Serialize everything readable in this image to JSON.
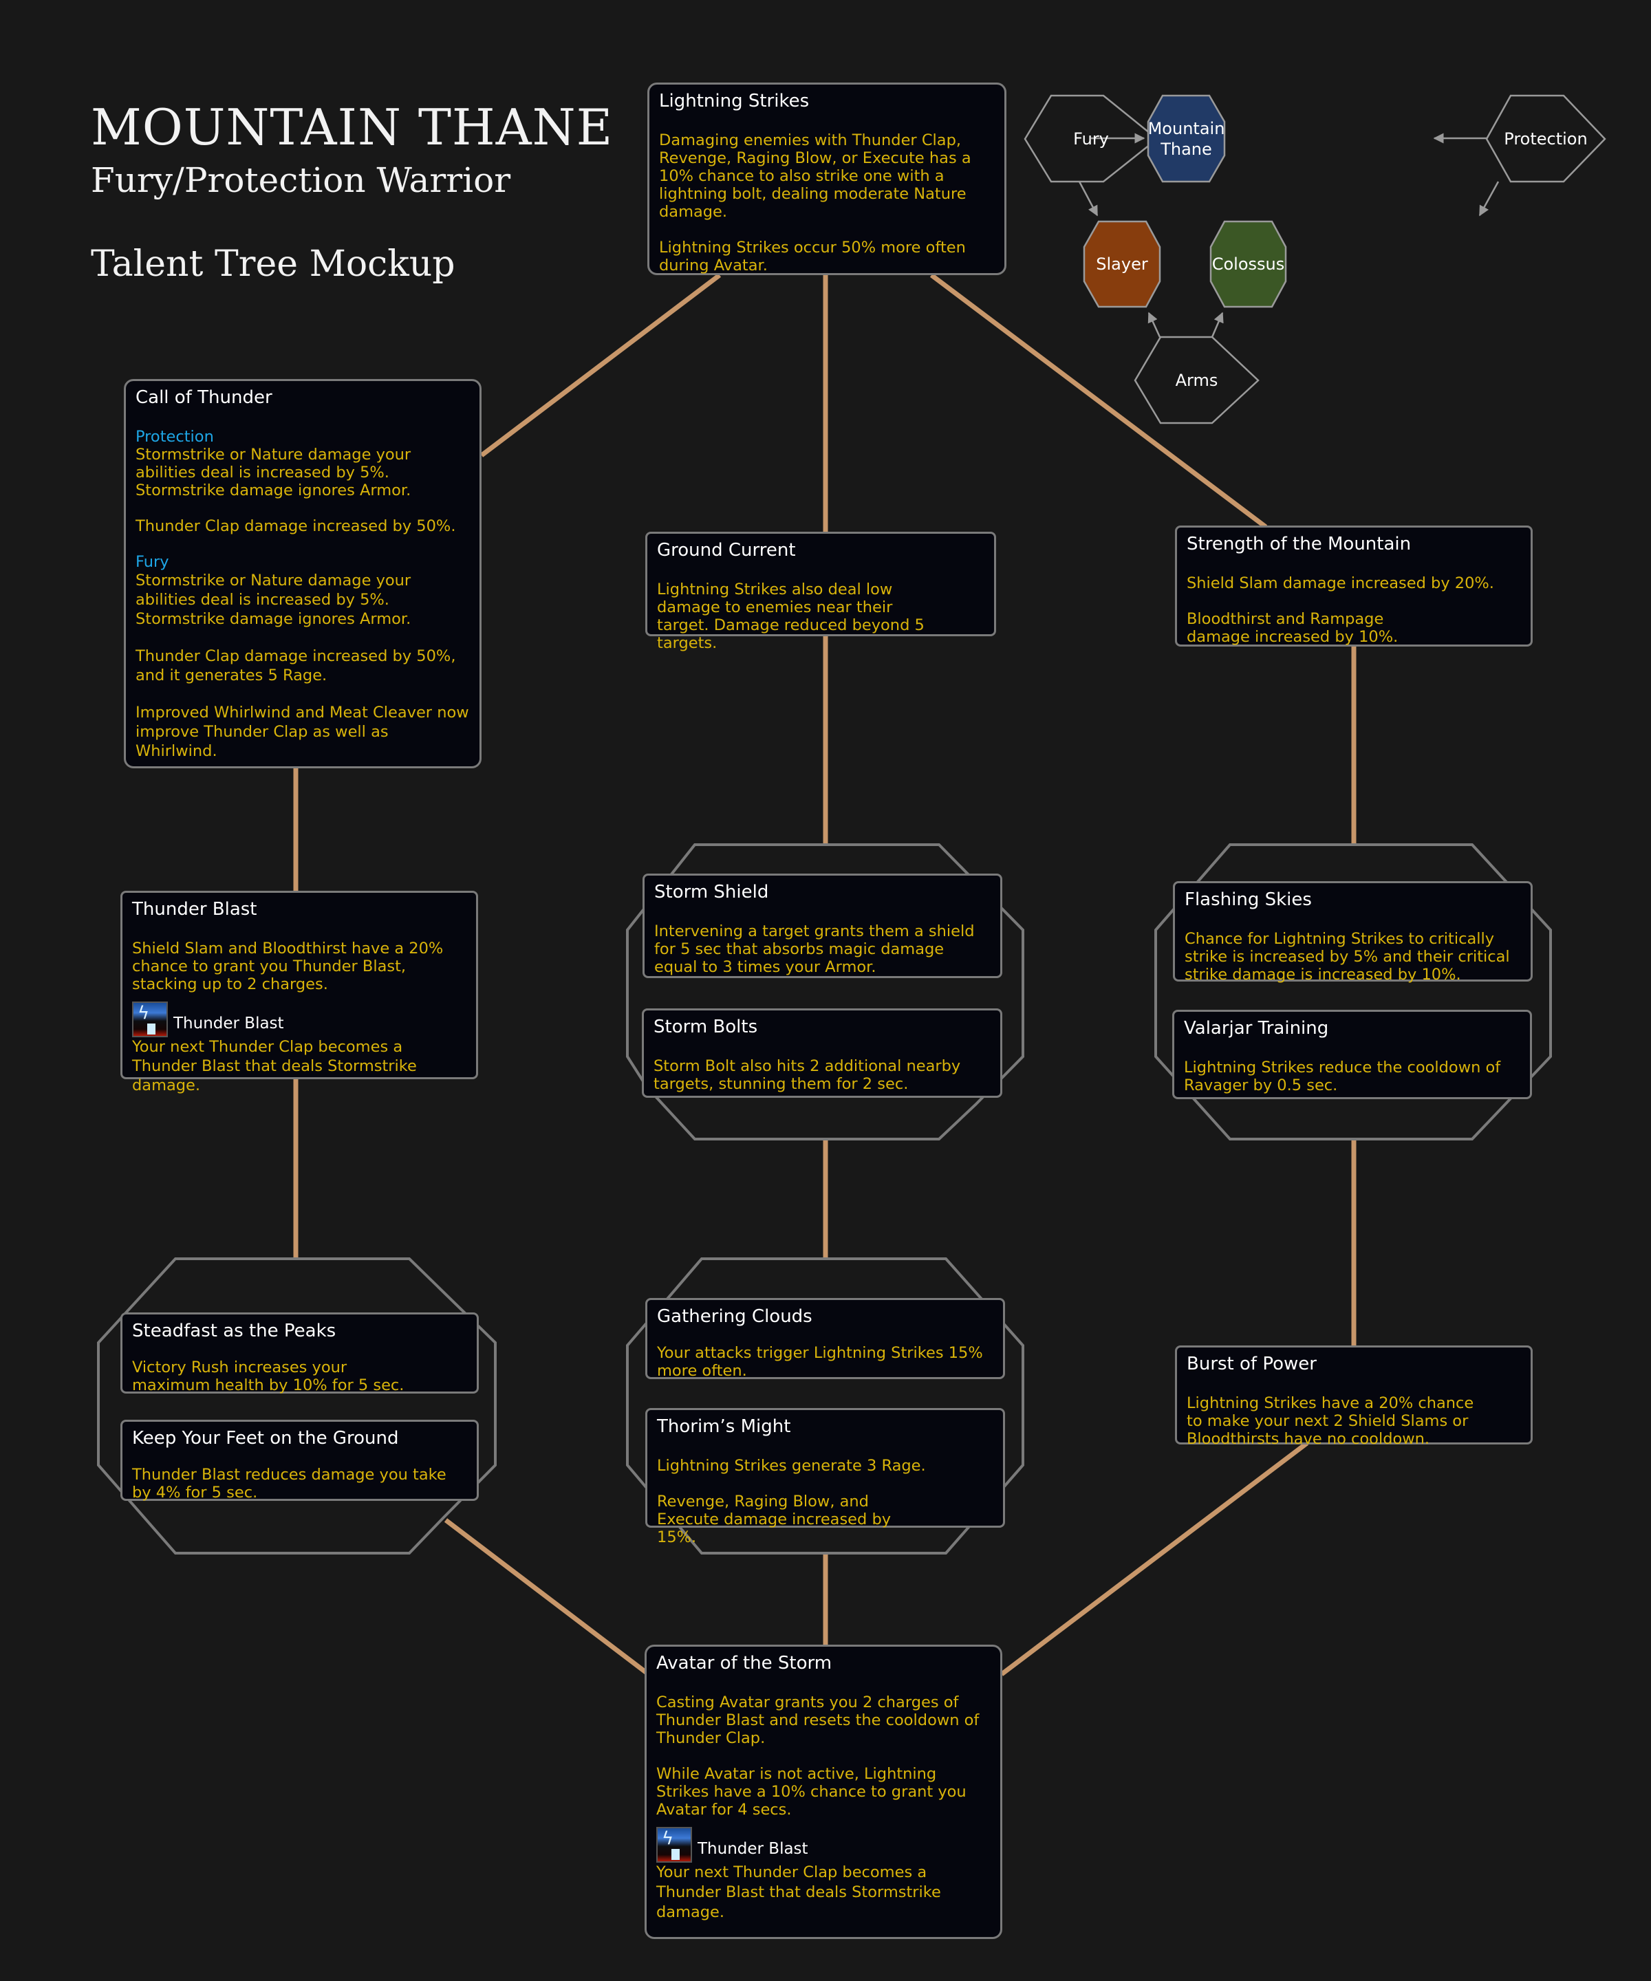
{
  "header": {
    "title": "MOUNTAIN THANE",
    "subtitle": "Fury/Protection Warrior",
    "caption": "Talent Tree Mockup"
  },
  "colors": {
    "background": "#181818",
    "card_bg": "#05060e",
    "card_border": "#7a7a7a",
    "connector": "#c8976a",
    "title_text": "#ffffff",
    "body_text": "#d9b40a",
    "spec_label": "#1ea6e6",
    "mountain_thane": "#213a66",
    "slayer": "#873d0d",
    "colossus": "#3b5725"
  },
  "spec_map": {
    "nodes": {
      "fury": "Fury",
      "mountain_thane_1": "Mountain",
      "mountain_thane_2": "Thane",
      "protection": "Protection",
      "slayer": "Slayer",
      "colossus": "Colossus",
      "arms": "Arms"
    },
    "edges": [
      {
        "from": "Fury",
        "to": "Mountain Thane"
      },
      {
        "from": "Protection",
        "to": "Mountain Thane"
      },
      {
        "from": "Fury",
        "to": "Slayer"
      },
      {
        "from": "Protection",
        "to": "Colossus"
      },
      {
        "from": "Arms",
        "to": "Slayer"
      },
      {
        "from": "Arms",
        "to": "Colossus"
      }
    ]
  },
  "talents": {
    "lightning_strikes": {
      "name": "Lightning Strikes",
      "p1": "Damaging enemies with Thunder Clap, Revenge, Raging Blow, or Execute has a 10% chance to also strike one with a lightning bolt, dealing moderate Nature damage.",
      "p2": "Lightning Strikes occur 50% more often during Avatar."
    },
    "call_of_thunder": {
      "name": "Call of Thunder",
      "spec1": "Protection",
      "p1": "Stormstrike or Nature damage your abilities deal is increased by 5%. Stormstrike damage ignores Armor.",
      "p2": "Thunder Clap damage increased by 50%.",
      "spec2": "Fury",
      "p3": "Stormstrike or Nature damage your abilities deal is increased by 5%. Stormstrike damage ignores Armor.",
      "p4": "Thunder Clap damage increased by 50%, and it generates 5 Rage.",
      "p5": "Improved Whirlwind and Meat Cleaver now improve Thunder Clap as well as Whirlwind."
    },
    "ground_current": {
      "name": "Ground Current",
      "p1": "Lightning Strikes also deal low damage to  enemies near their target. Damage reduced beyond 5 targets."
    },
    "strength_of_the_mountain": {
      "name": "Strength of the Mountain",
      "p1": "Shield Slam damage increased by 20%.",
      "p2": "Bloodthirst and Rampage damage increased by 10%."
    },
    "thunder_blast": {
      "name": "Thunder Blast",
      "p1": "Shield Slam and Bloodthirst have a 20% chance to grant you Thunder Blast, stacking up to 2 charges.",
      "ability_name": "Thunder Blast",
      "ability_desc": "Your next Thunder Clap becomes a Thunder Blast that deals Stormstrike damage."
    },
    "storm_shield": {
      "name": "Storm Shield",
      "p1": "Intervening a target grants them a shield for 5 sec that absorbs magic damage equal to 3 times your Armor."
    },
    "storm_bolts": {
      "name": "Storm Bolts",
      "p1": "Storm Bolt also hits 2 additional nearby targets, stunning them for 2 sec."
    },
    "flashing_skies": {
      "name": "Flashing Skies",
      "p1": "Chance for Lightning Strikes to critically strike is increased by 5% and their critical strike damage is increased by 10%."
    },
    "valarjar_training": {
      "name": "Valarjar Training",
      "p1": "Lightning Strikes reduce the cooldown of Ravager by 0.5 sec."
    },
    "steadfast_as_the_peaks": {
      "name": "Steadfast as the Peaks",
      "p1": "Victory Rush increases your maximum health by 10% for 5 sec."
    },
    "keep_your_feet_on_the_ground": {
      "name": "Keep Your Feet on the Ground",
      "p1": "Thunder Blast reduces damage you take by 4% for 5 sec."
    },
    "gathering_clouds": {
      "name": "Gathering Clouds",
      "p1": "Your attacks trigger Lightning Strikes 15% more often."
    },
    "thorims_might": {
      "name": "Thorim’s Might",
      "p1": "Lightning Strikes generate 3 Rage.",
      "p2": "Revenge, Raging Blow, and Execute damage increased by 15%."
    },
    "burst_of_power": {
      "name": "Burst of Power",
      "p1": "Lightning Strikes have a 20% chance to make your next 2 Shield Slams or Bloodthirsts have no cooldown."
    },
    "avatar_of_the_storm": {
      "name": "Avatar of the Storm",
      "p1": "Casting Avatar grants you 2 charges of Thunder Blast and resets the cooldown of Thunder Clap.",
      "p2": "While Avatar is not active, Lightning Strikes have a 10% chance to grant you Avatar for 4 secs.",
      "ability_name": "Thunder Blast",
      "ability_desc": "Your next Thunder Clap becomes a Thunder Blast that deals Stormstrike damage."
    }
  },
  "tree_edges": [
    {
      "from": "Lightning Strikes",
      "to": "Call of Thunder"
    },
    {
      "from": "Lightning Strikes",
      "to": "Ground Current"
    },
    {
      "from": "Lightning Strikes",
      "to": "Strength of the Mountain"
    },
    {
      "from": "Call of Thunder",
      "to": "Thunder Blast"
    },
    {
      "from": "Ground Current",
      "to": "Storm Shield / Storm Bolts (choice)"
    },
    {
      "from": "Strength of the Mountain",
      "to": "Flashing Skies / Valarjar Training (choice)"
    },
    {
      "from": "Thunder Blast",
      "to": "Steadfast as the Peaks / Keep Your Feet on the Ground (choice)"
    },
    {
      "from": "Storm Shield / Storm Bolts (choice)",
      "to": "Gathering Clouds / Thorim’s Might (choice)"
    },
    {
      "from": "Flashing Skies / Valarjar Training (choice)",
      "to": "Burst of Power"
    },
    {
      "from": "Steadfast as the Peaks / Keep Your Feet on the Ground (choice)",
      "to": "Avatar of the Storm"
    },
    {
      "from": "Gathering Clouds / Thorim’s Might (choice)",
      "to": "Avatar of the Storm"
    },
    {
      "from": "Burst of Power",
      "to": "Avatar of the Storm"
    }
  ]
}
